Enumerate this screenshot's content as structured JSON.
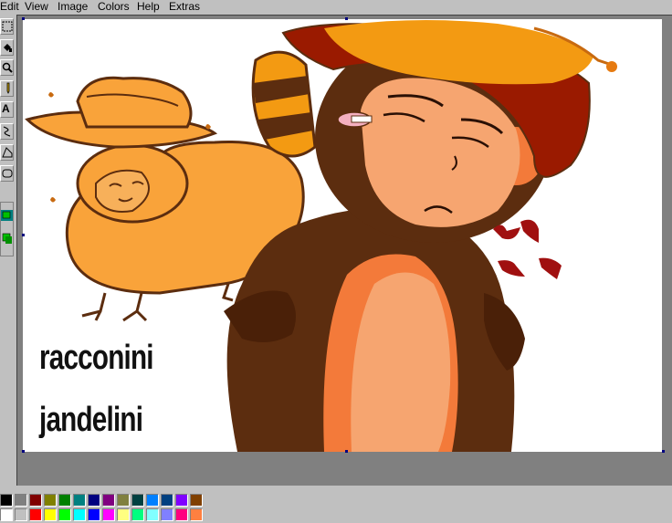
{
  "menu": {
    "items": [
      {
        "key": "edit",
        "label": "Edit"
      },
      {
        "key": "view",
        "label": "View"
      },
      {
        "key": "image",
        "label": "Image"
      },
      {
        "key": "colors",
        "label": "Colors"
      },
      {
        "key": "help",
        "label": "Help"
      },
      {
        "key": "extras",
        "label": "Extras"
      }
    ]
  },
  "tools": [
    {
      "name": "select-tool-icon"
    },
    {
      "name": "fill-bucket-icon"
    },
    {
      "name": "magnifier-icon"
    },
    {
      "name": "pencil-icon"
    },
    {
      "name": "text-tool-icon",
      "glyph": "A"
    },
    {
      "name": "curve-tool-icon"
    },
    {
      "name": "polygon-tool-icon"
    },
    {
      "name": "rounded-rect-tool-icon"
    }
  ],
  "canvas": {
    "text_line1": "racconini",
    "text_line2": "jandelini"
  },
  "palette": {
    "row1": [
      "#000000",
      "#808080",
      "#800000",
      "#808000",
      "#008000",
      "#008080",
      "#000080",
      "#800080",
      "#808040",
      "#004040",
      "#0080ff",
      "#004080",
      "#8000ff",
      "#804000"
    ],
    "row2": [
      "#ffffff",
      "#c0c0c0",
      "#ff0000",
      "#ffff00",
      "#00ff00",
      "#00ffff",
      "#0000ff",
      "#ff00ff",
      "#ffff80",
      "#00ff80",
      "#80ffff",
      "#8080ff",
      "#ff0080",
      "#ff8040"
    ]
  },
  "colors": {
    "monkey_brown": "#5c2d0f",
    "monkey_light": "#f6a570",
    "hat_red": "#9a1a00",
    "hat_orange": "#f39a12",
    "small_monkey": "#f9a33a",
    "anger_mark": "#a01010"
  }
}
